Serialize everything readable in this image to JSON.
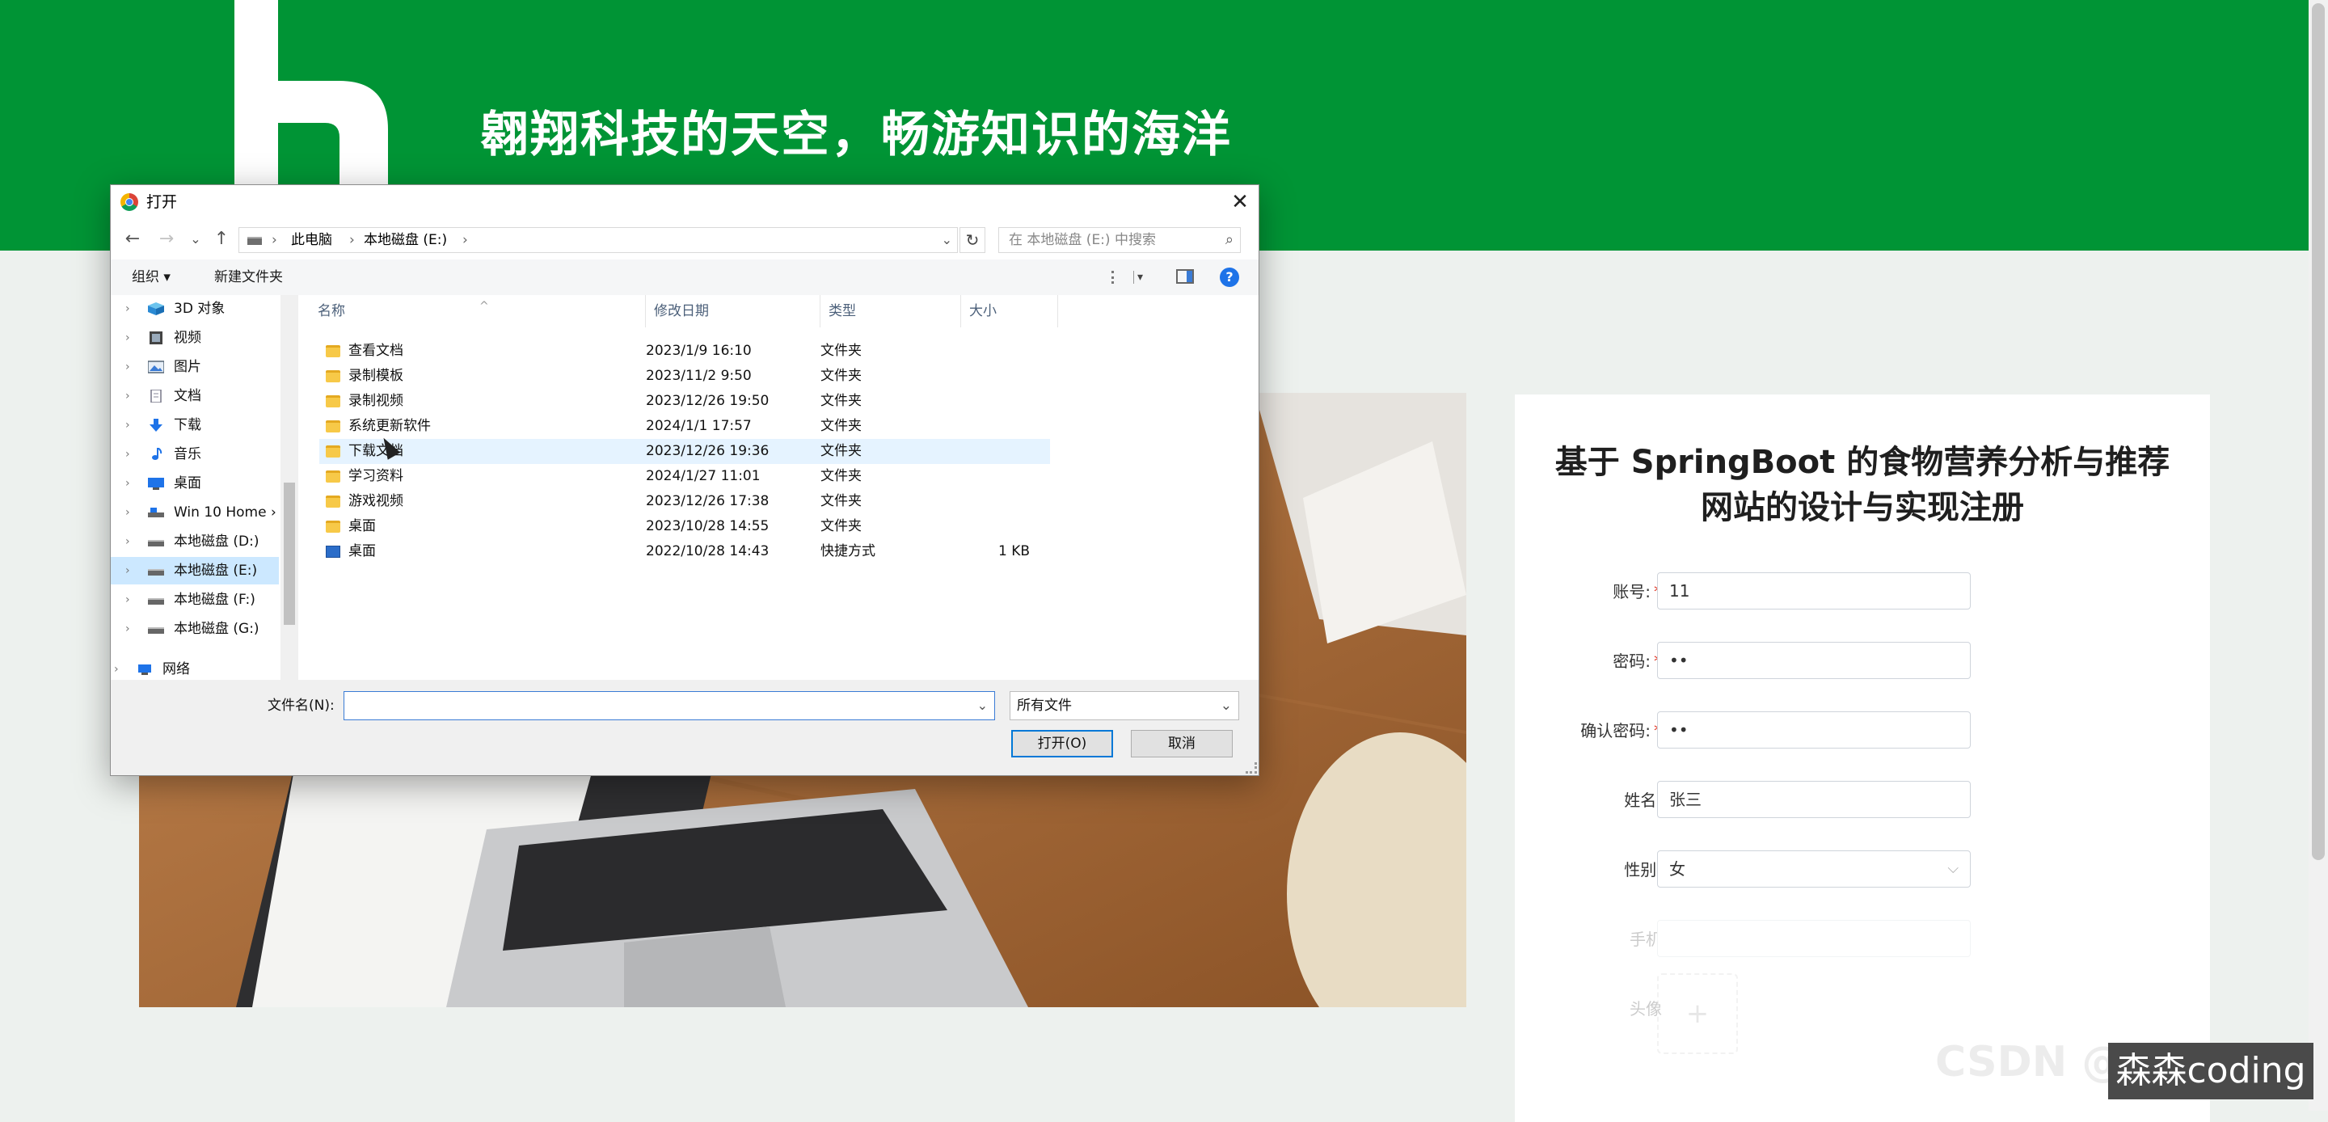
{
  "page": {
    "slogan": "翱翔科技的天空，畅游知识的海洋",
    "brand_color": "#009435",
    "watermark": "森森coding"
  },
  "register": {
    "title_line1": "基于 SpringBoot 的食物营养分析与推荐",
    "title_line2": "网站的设计与实现注册",
    "fields": [
      {
        "label": "账号:",
        "value": "11",
        "required": true
      },
      {
        "label": "密码:",
        "value": "••",
        "required": true
      },
      {
        "label": "确认密码:",
        "value": "••",
        "required": true
      },
      {
        "label": "姓名:",
        "value": "张三",
        "required": false
      },
      {
        "label": "性别:",
        "value": "女",
        "required": false
      },
      {
        "label": "手机",
        "value": "",
        "required": false
      },
      {
        "label": "头像",
        "value": "",
        "required": false
      }
    ],
    "required_mark": "*",
    "gender_chevron": "⌵",
    "upload_plus": "+",
    "watermark_faint": "CSDN @..."
  },
  "dialog": {
    "title": "打开",
    "close_glyph": "✕",
    "nav": {
      "back": "←",
      "forward": "→",
      "recent": "⌄",
      "up": "↑"
    },
    "breadcrumb": [
      "此电脑",
      "本地磁盘 (E:)"
    ],
    "breadcrumb_sep": "›",
    "address_dropdown": "⌄",
    "refresh_glyph": "↻",
    "search_placeholder": "在 本地磁盘 (E:) 中搜索",
    "search_icon": "⌕",
    "toolbar": {
      "organize": "组织 ▾",
      "new_folder": "新建文件夹",
      "view_dropdown": "▾",
      "help": "?"
    },
    "sidebar": [
      {
        "label": "3D 对象",
        "icon": "cube-icon"
      },
      {
        "label": "视频",
        "icon": "video-icon"
      },
      {
        "label": "图片",
        "icon": "picture-icon"
      },
      {
        "label": "文档",
        "icon": "document-icon"
      },
      {
        "label": "下载",
        "icon": "download-icon"
      },
      {
        "label": "音乐",
        "icon": "music-icon"
      },
      {
        "label": "桌面",
        "icon": "desktop-icon"
      },
      {
        "label": "Win 10 Home ›",
        "icon": "drive-icon"
      },
      {
        "label": "本地磁盘 (D:)",
        "icon": "drive-icon"
      },
      {
        "label": "本地磁盘 (E:)",
        "icon": "drive-icon",
        "selected": true
      },
      {
        "label": "本地磁盘 (F:)",
        "icon": "drive-icon"
      },
      {
        "label": "本地磁盘 (G:)",
        "icon": "drive-icon"
      },
      {
        "label": "网络",
        "icon": "network-icon"
      }
    ],
    "sidebar_caret": "›",
    "columns": {
      "name": "名称",
      "modified": "修改日期",
      "type": "类型",
      "size": "大小",
      "sort_indicator": "^"
    },
    "files": [
      {
        "name": "查看文档",
        "modified": "2023/1/9 16:10",
        "type": "文件夹",
        "size": ""
      },
      {
        "name": "录制模板",
        "modified": "2023/11/2 9:50",
        "type": "文件夹",
        "size": ""
      },
      {
        "name": "录制视频",
        "modified": "2023/12/26 19:50",
        "type": "文件夹",
        "size": ""
      },
      {
        "name": "系统更新软件",
        "modified": "2024/1/1 17:57",
        "type": "文件夹",
        "size": ""
      },
      {
        "name": "下载文档",
        "modified": "2023/12/26 19:36",
        "type": "文件夹",
        "size": ""
      },
      {
        "name": "学习资料",
        "modified": "2024/1/27 11:01",
        "type": "文件夹",
        "size": ""
      },
      {
        "name": "游戏视频",
        "modified": "2023/12/26 17:38",
        "type": "文件夹",
        "size": ""
      },
      {
        "name": "桌面",
        "modified": "2023/10/28 14:55",
        "type": "文件夹",
        "size": ""
      },
      {
        "name": "桌面",
        "modified": "2022/10/28 14:43",
        "type": "快捷方式",
        "size": "1 KB"
      }
    ],
    "filename_label": "文件名(N):",
    "filename_value": "",
    "filename_dropdown": "⌄",
    "filetype": "所有文件",
    "filetype_dropdown": "⌄",
    "open_button": "打开(O)",
    "cancel_button": "取消"
  }
}
